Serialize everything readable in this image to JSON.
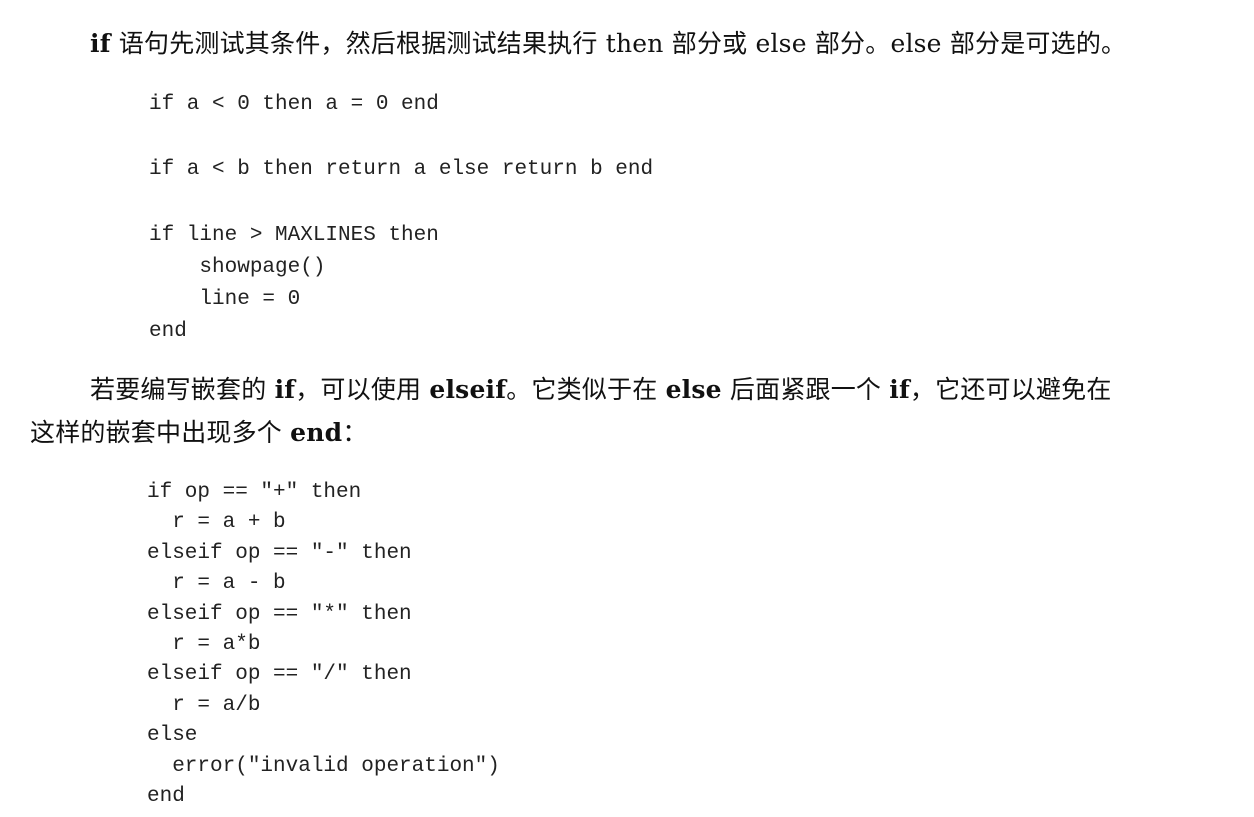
{
  "paragraph1": {
    "kw_if": "if",
    "text1": " 语句先测试其条件，然后根据测试结果执行 then 部分或 else 部分。else 部分是可选的。"
  },
  "code_block_1": {
    "example1": [
      "if a < 0 then a = 0 end"
    ],
    "example2": [
      "if a < b then return a else return b end"
    ],
    "example3": [
      "if line > MAXLINES then",
      "    showpage()",
      "    line = 0",
      "end"
    ]
  },
  "paragraph2": {
    "line1_a": "若要编写嵌套的 ",
    "kw_if1": "if",
    "line1_b": "，可以使用 ",
    "kw_elseif": "elseif",
    "line1_c": "。它类似于在 ",
    "kw_else": "else",
    "line1_d": " 后面紧跟一个 ",
    "kw_if2": "if",
    "line1_e": "，它还可以避免在",
    "line2_a": "这样的嵌套中出现多个 ",
    "kw_end": "end",
    "line2_b": "："
  },
  "code_block_2": {
    "lines": [
      "if op == \"+\" then",
      "  r = a + b",
      "elseif op == \"-\" then",
      "  r = a - b",
      "elseif op == \"*\" then",
      "  r = a*b",
      "elseif op == \"/\" then",
      "  r = a/b",
      "else",
      "  error(\"invalid operation\")",
      "end"
    ]
  }
}
